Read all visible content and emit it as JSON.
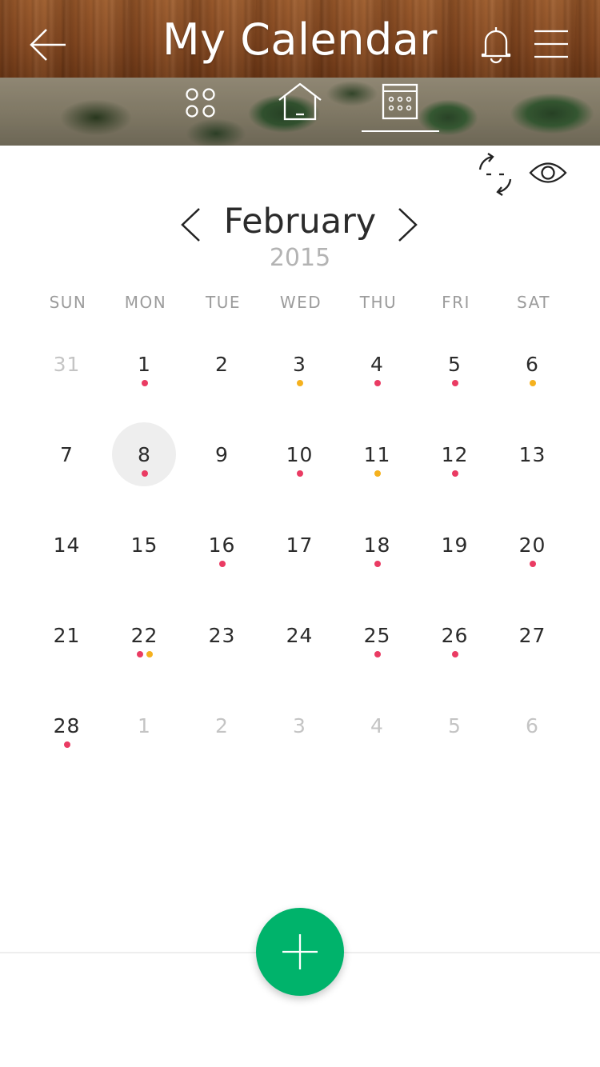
{
  "header": {
    "title": "My Calendar",
    "back_icon": "arrow-left-icon",
    "bell_icon": "bell-icon",
    "menu_icon": "hamburger-menu-icon",
    "wood_color": "#874a22"
  },
  "nav_tabs": [
    {
      "id": "apps",
      "icon": "four-circles-icon",
      "active": false
    },
    {
      "id": "home",
      "icon": "home-icon",
      "active": false
    },
    {
      "id": "calendar",
      "icon": "calendar-grid-icon",
      "active": true
    }
  ],
  "toolbar": {
    "sync_icon": "sync-arrows-icon",
    "view_icon": "eye-icon"
  },
  "month_nav": {
    "month": "February",
    "year": "2015",
    "prev_icon": "chevron-left-icon",
    "next_icon": "chevron-right-icon"
  },
  "weekdays": [
    "SUN",
    "MON",
    "TUE",
    "WED",
    "THU",
    "FRI",
    "SAT"
  ],
  "colors": {
    "dot_red": "#ea3b63",
    "dot_orange": "#f5b11e",
    "fab_green": "#00b36b",
    "muted_text": "#c4c4c4",
    "selected_bg": "#eeeeee"
  },
  "weeks": [
    [
      {
        "day": "31",
        "muted": true,
        "dots": []
      },
      {
        "day": "1",
        "dots": [
          "red"
        ]
      },
      {
        "day": "2",
        "dots": []
      },
      {
        "day": "3",
        "dots": [
          "orange"
        ]
      },
      {
        "day": "4",
        "dots": [
          "red"
        ]
      },
      {
        "day": "5",
        "dots": [
          "red"
        ]
      },
      {
        "day": "6",
        "dots": [
          "orange"
        ]
      }
    ],
    [
      {
        "day": "7",
        "dots": []
      },
      {
        "day": "8",
        "selected": true,
        "dots": [
          "red"
        ]
      },
      {
        "day": "9",
        "dots": []
      },
      {
        "day": "10",
        "dots": [
          "red"
        ]
      },
      {
        "day": "11",
        "dots": [
          "orange"
        ]
      },
      {
        "day": "12",
        "dots": [
          "red"
        ]
      },
      {
        "day": "13",
        "dots": []
      }
    ],
    [
      {
        "day": "14",
        "dots": []
      },
      {
        "day": "15",
        "dots": []
      },
      {
        "day": "16",
        "dots": [
          "red"
        ]
      },
      {
        "day": "17",
        "dots": []
      },
      {
        "day": "18",
        "dots": [
          "red"
        ]
      },
      {
        "day": "19",
        "dots": []
      },
      {
        "day": "20",
        "dots": [
          "red"
        ]
      }
    ],
    [
      {
        "day": "21",
        "dots": []
      },
      {
        "day": "22",
        "dots": [
          "red",
          "orange"
        ]
      },
      {
        "day": "23",
        "dots": []
      },
      {
        "day": "24",
        "dots": []
      },
      {
        "day": "25",
        "dots": [
          "red"
        ]
      },
      {
        "day": "26",
        "dots": [
          "red"
        ]
      },
      {
        "day": "27",
        "dots": []
      }
    ],
    [
      {
        "day": "28",
        "dots": [
          "red"
        ]
      },
      {
        "day": "1",
        "muted": true,
        "dots": []
      },
      {
        "day": "2",
        "muted": true,
        "dots": []
      },
      {
        "day": "3",
        "muted": true,
        "dots": []
      },
      {
        "day": "4",
        "muted": true,
        "dots": []
      },
      {
        "day": "5",
        "muted": true,
        "dots": []
      },
      {
        "day": "6",
        "muted": true,
        "dots": []
      }
    ]
  ],
  "fab": {
    "icon": "plus-icon"
  }
}
